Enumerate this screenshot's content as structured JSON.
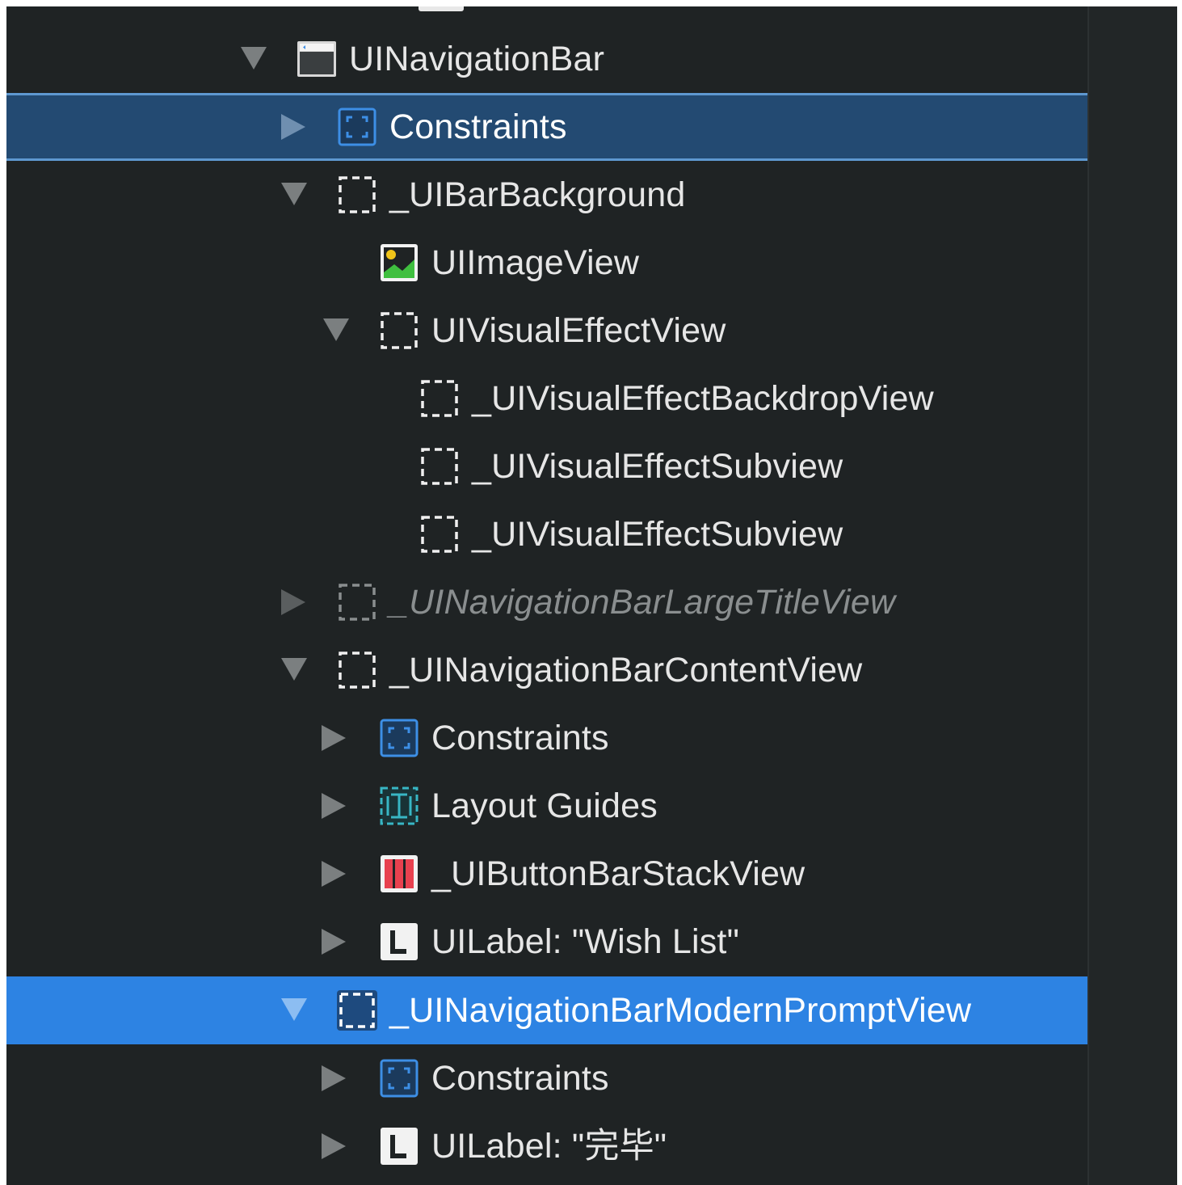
{
  "outline": {
    "rows": [
      {
        "label": "UINavigationBar",
        "icon": "navigation-bar-icon",
        "disclosure": "expanded"
      },
      {
        "label": "Constraints",
        "icon": "constraints-icon",
        "disclosure": "collapsed",
        "state": "selected-unfocused"
      },
      {
        "label": "_UIBarBackground",
        "icon": "view-icon",
        "disclosure": "expanded"
      },
      {
        "label": "UIImageView",
        "icon": "image-view-icon",
        "disclosure": "none"
      },
      {
        "label": "UIVisualEffectView",
        "icon": "view-icon",
        "disclosure": "expanded"
      },
      {
        "label": "_UIVisualEffectBackdropView",
        "icon": "view-icon",
        "disclosure": "none"
      },
      {
        "label": "_UIVisualEffectSubview",
        "icon": "view-icon",
        "disclosure": "none"
      },
      {
        "label": "_UIVisualEffectSubview",
        "icon": "view-icon",
        "disclosure": "none"
      },
      {
        "label": "_UINavigationBarLargeTitleView",
        "icon": "view-icon",
        "disclosure": "collapsed",
        "state": "hidden"
      },
      {
        "label": "_UINavigationBarContentView",
        "icon": "view-icon",
        "disclosure": "expanded"
      },
      {
        "label": "Constraints",
        "icon": "constraints-icon",
        "disclosure": "collapsed"
      },
      {
        "label": "Layout Guides",
        "icon": "layout-guides-icon",
        "disclosure": "collapsed"
      },
      {
        "label": "_UIButtonBarStackView",
        "icon": "stack-view-icon",
        "disclosure": "collapsed"
      },
      {
        "label": "UILabel: \"Wish List\"",
        "icon": "label-icon",
        "disclosure": "collapsed"
      },
      {
        "label": "_UINavigationBarModernPromptView",
        "icon": "view-icon",
        "disclosure": "expanded",
        "state": "selected"
      },
      {
        "label": "Constraints",
        "icon": "constraints-icon",
        "disclosure": "collapsed"
      },
      {
        "label": "UILabel: \"完毕\"",
        "icon": "label-icon",
        "disclosure": "collapsed"
      }
    ]
  },
  "colors": {
    "background": "#1f2324",
    "selected": "#2d83e3",
    "selected_unfocused": "#234a72",
    "constraints_blue": "#3d8fe6",
    "layout_guides_teal": "#38b6c4",
    "stack_view_red": "#e8414f",
    "image_green": "#3fbf3f",
    "image_yellow": "#f0c419"
  }
}
